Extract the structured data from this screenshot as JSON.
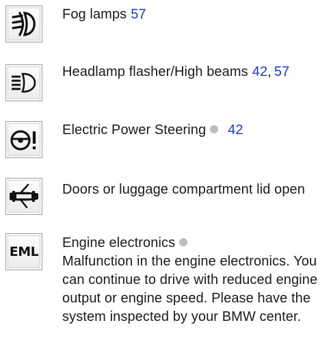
{
  "entries": [
    {
      "icon": "fog-lamp-icon",
      "title": "Fog lamps",
      "refs": [
        "57"
      ]
    },
    {
      "icon": "high-beam-icon",
      "title": "Headlamp flasher/High beams",
      "refs": [
        "42",
        "57"
      ],
      "separator": ","
    },
    {
      "icon": "power-steering-warning-icon",
      "title": "Electric Power Steering",
      "refs": [
        "42"
      ]
    },
    {
      "icon": "door-open-icon",
      "title": "Doors or luggage compartment lid open"
    },
    {
      "icon": "engine-electronics-icon",
      "icon_label": "EML",
      "title": "Engine electronics",
      "description": "Malfunction in the engine electronics. You can continue to drive with reduced engine output or engine speed. Please have the system inspected by your BMW center."
    }
  ],
  "colors": {
    "link": "#1a3ccc",
    "indicator_dot": "#bdbdbd",
    "text": "#1a1a1a"
  }
}
